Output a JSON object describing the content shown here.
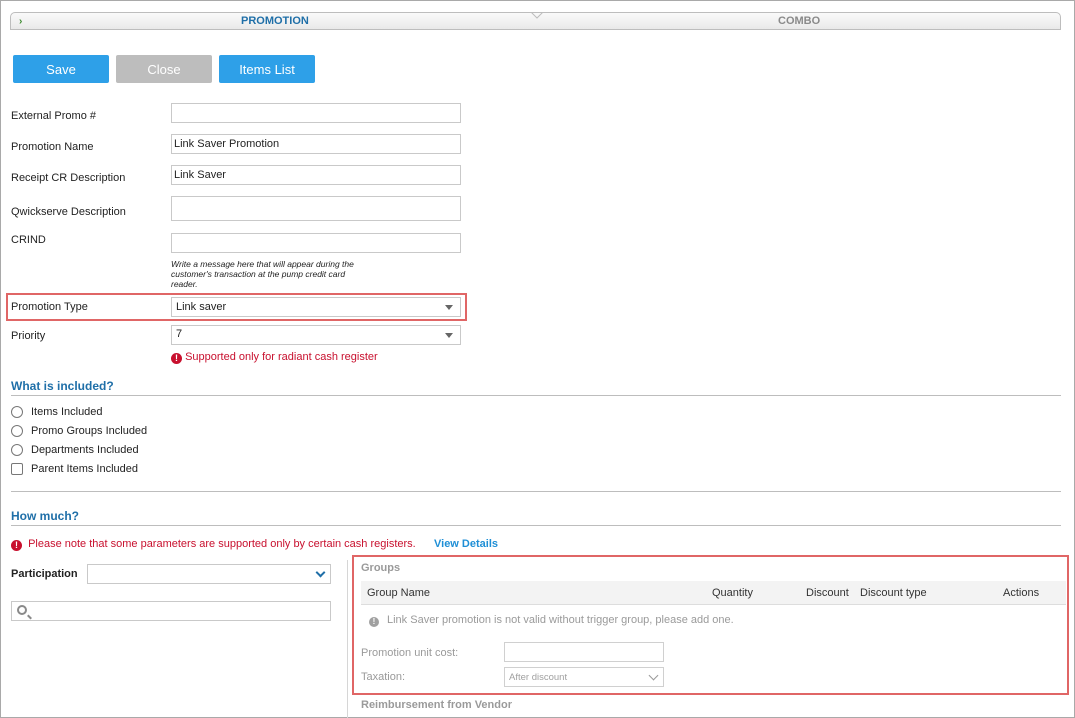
{
  "wizard": {
    "steps": [
      "PROMOTION",
      "COMBO"
    ]
  },
  "toolbar": {
    "save": "Save",
    "close": "Close",
    "items_list": "Items List"
  },
  "form": {
    "external_promo": {
      "label": "External Promo #",
      "value": ""
    },
    "promotion_name": {
      "label": "Promotion Name",
      "value": "Link Saver Promotion"
    },
    "receipt_cr": {
      "label": "Receipt CR Description",
      "value": "Link Saver"
    },
    "qwickserve": {
      "label": "Qwickserve Description",
      "value": ""
    },
    "crind": {
      "label": "CRIND",
      "value": "",
      "hint": "Write a message here that will appear during the customer's transaction at the pump credit card reader."
    },
    "promotion_type": {
      "label": "Promotion Type",
      "value": "Link saver"
    },
    "priority": {
      "label": "Priority",
      "value": "7",
      "warning": "Supported only for radiant cash register"
    }
  },
  "included": {
    "title": "What is included?",
    "options": [
      "Items Included",
      "Promo Groups Included",
      "Departments Included",
      "Parent Items Included"
    ]
  },
  "how_much": {
    "title": "How much?",
    "note": "Please note that some parameters are supported only by certain cash registers.",
    "view_details": "View Details",
    "participation_label": "Participation",
    "participation_value": ""
  },
  "groups": {
    "title": "Groups",
    "columns": [
      "Group Name",
      "Quantity",
      "Discount",
      "Discount type",
      "Actions"
    ],
    "empty_message": "Link Saver promotion is not valid without trigger group, please add one.",
    "unit_cost_label": "Promotion unit cost:",
    "unit_cost_value": "",
    "taxation_label": "Taxation:",
    "taxation_value": "After discount"
  },
  "reimbursement": {
    "title": "Reimbursement from Vendor"
  },
  "colors": {
    "accent": "#2ea0e8",
    "title_blue": "#1f6fa8",
    "error": "#c8102e",
    "highlight": "#e06666"
  }
}
